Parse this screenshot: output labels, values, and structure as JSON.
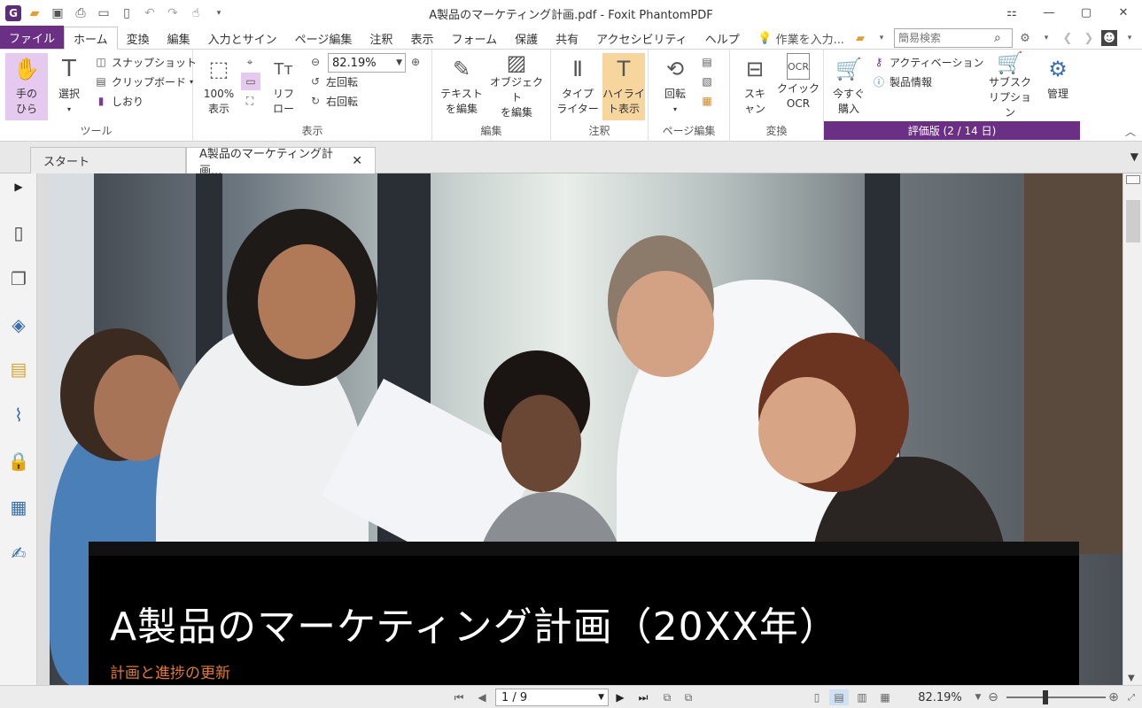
{
  "window": {
    "title": "A製品のマーケティング計画.pdf - Foxit PhantomPDF",
    "logo_letter": "G"
  },
  "menu": {
    "file": "ファイル",
    "tabs": [
      "ホーム",
      "変換",
      "編集",
      "入力とサイン",
      "ページ編集",
      "注釈",
      "表示",
      "フォーム",
      "保護",
      "共有",
      "アクセシビリティ",
      "ヘルプ"
    ],
    "tell_me": "作業を入力...",
    "search_placeholder": "簡易検索"
  },
  "ribbon": {
    "tools": {
      "hand": "手の\nひら",
      "select": "選択",
      "snapshot": "スナップショット",
      "clipboard": "クリップボード",
      "bookmark": "しおり",
      "label": "ツール"
    },
    "view": {
      "actual_size": "100%\n表示",
      "reflow": "リフ\nロー",
      "zoom_value": "82.19%",
      "rotate_left": "左回転",
      "rotate_right": "右回転",
      "label": "表示"
    },
    "edit": {
      "edit_text": "テキスト\nを編集",
      "edit_object": "オブジェクト\nを編集",
      "label": "編集"
    },
    "comment": {
      "typewriter": "タイプ\nライター",
      "highlight": "ハイライ\nト表示",
      "label": "注釈"
    },
    "page": {
      "rotate": "回転",
      "label": "ページ編集"
    },
    "convert": {
      "scan": "スキ\nャン",
      "quick_ocr": "クイック\nOCR",
      "label": "変換"
    },
    "purchase": {
      "buy_now": "今すぐ\n購入",
      "activation": "アクティベーション",
      "product_info": "製品情報",
      "subscription": "サブスク\nリプション",
      "manage": "管理",
      "trial_banner": "評価版 (2 / 14 日)"
    }
  },
  "doc_tabs": {
    "start": "スタート",
    "current": "A製品のマーケティング計画..."
  },
  "document": {
    "title": "A製品のマーケティング計画（20XX年）",
    "subtitle": "計画と進捗の更新"
  },
  "status": {
    "page_indicator": "1 / 9",
    "zoom": "82.19%"
  },
  "colors": {
    "accent_purple": "#6b2f86",
    "subtitle_orange": "#e07a28"
  }
}
